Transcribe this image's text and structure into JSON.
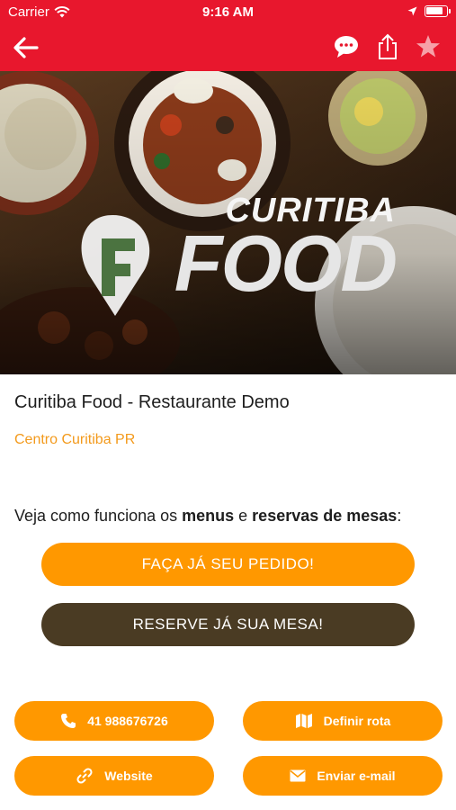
{
  "status": {
    "carrier": "Carrier",
    "time": "9:16 AM",
    "battery_level": 0.9
  },
  "nav": {
    "back_icon": "back-arrow-icon",
    "chat_icon": "chat-bubble-icon",
    "share_icon": "share-icon",
    "favorite_icon": "star-icon"
  },
  "hero": {
    "logo_line1": "CURITIBA",
    "logo_line2": "FOOD"
  },
  "restaurant": {
    "name": "Curitiba Food - Restaurante Demo",
    "location": "Centro Curitiba PR"
  },
  "intro": {
    "prefix": "Veja como funciona os ",
    "menus": "menus",
    "middle": " e ",
    "reservas": "reservas de mesas",
    "suffix": ":"
  },
  "buttons": {
    "order": "FAÇA JÁ SEU PEDIDO!",
    "reserve": "RESERVE JÁ SUA MESA!",
    "phone": "41 988676726",
    "route": "Definir rota",
    "website": "Website",
    "email": "Enviar e-mail"
  },
  "colors": {
    "nav_red": "#e8172d",
    "accent_orange": "#ff9800",
    "location_orange": "#f39a1c",
    "reserve_brown": "#4a3b23"
  }
}
